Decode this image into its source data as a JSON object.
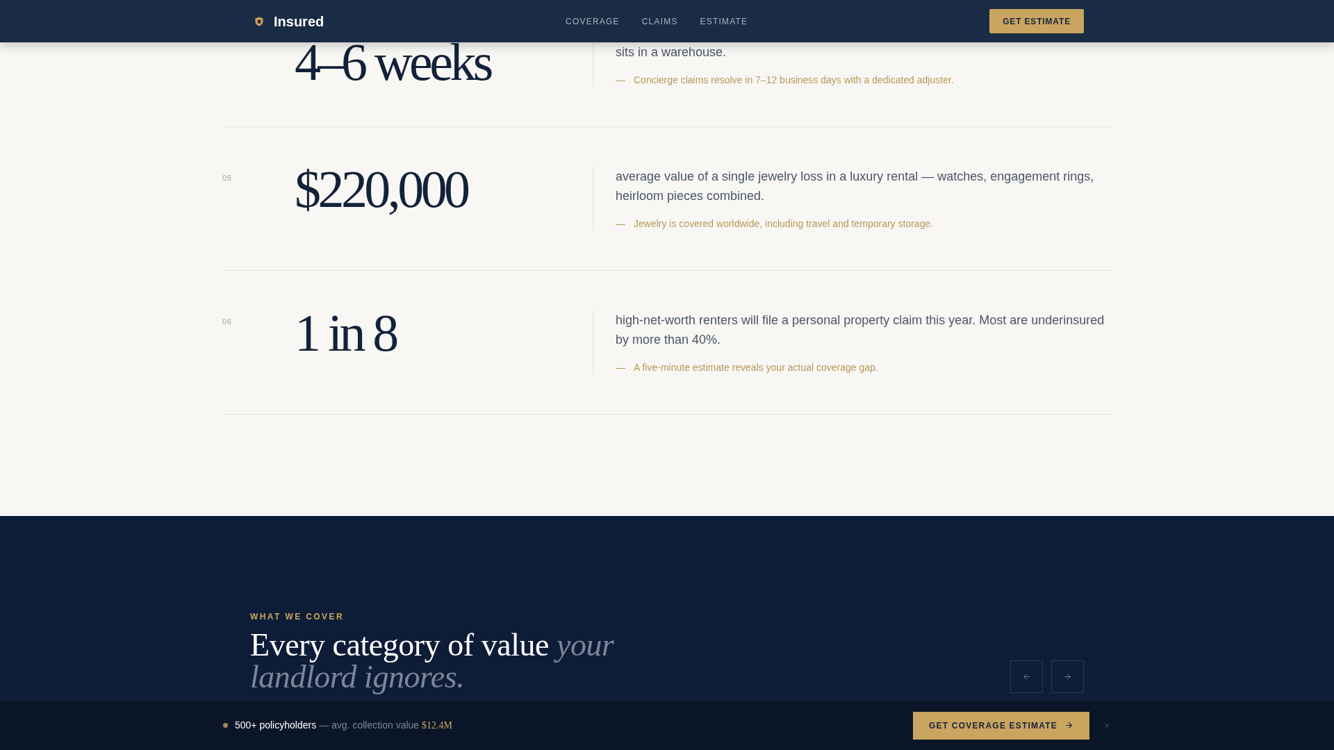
{
  "header": {
    "brand": "Insured",
    "nav": [
      {
        "label": "COVERAGE"
      },
      {
        "label": "CLAIMS"
      },
      {
        "label": "ESTIMATE"
      }
    ],
    "cta": "GET ESTIMATE"
  },
  "stats": [
    {
      "value": "4–6 weeks",
      "description": "sits in a warehouse.",
      "note_mark": "—",
      "note": "Concierge claims resolve in 7–12 business days with a dedicated adjuster."
    },
    {
      "index": "05",
      "value": "$220,000",
      "description": "average value of a single jewelry loss in a luxury rental — watches, engagement rings, heirloom pieces combined.",
      "note_mark": "—",
      "note": "Jewelry is covered worldwide, including travel and temporary storage."
    },
    {
      "index": "06",
      "value": "1 in 8",
      "description": "high-net-worth renters will file a personal property claim this year. Most are underinsured by more than 40%.",
      "note_mark": "—",
      "note": "A five-minute estimate reveals your actual coverage gap."
    }
  ],
  "coverage": {
    "eyebrow": "WHAT WE COVER",
    "title": "Every category of value *your landlord ignores.*"
  },
  "sticky_bar": {
    "count": "500+ policyholders",
    "detail": "— avg. collection value",
    "value": "$12.4M",
    "cta": "GET COVERAGE ESTIMATE"
  }
}
